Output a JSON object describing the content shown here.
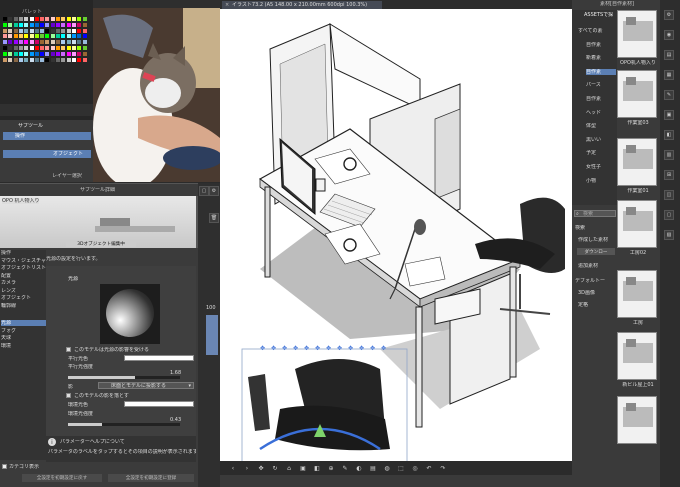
{
  "color_set_panel": {
    "title": "パレット"
  },
  "layer_panel": {
    "tools": [
      "サブツール"
    ],
    "items": [
      {
        "label": "操作"
      },
      {
        "label": "オブジェクト"
      }
    ],
    "footer": "レイヤー選択"
  },
  "subtool_detail": {
    "title": "サブツール詳細",
    "object_name": "OPO 机人物入り",
    "edit_button": "3Dオブジェクト編集中",
    "description": "光源の設定を行います。",
    "categories": [
      "操作",
      "マウス・ジェスチャー",
      "オブジェクトリスト",
      "配置",
      "カメラ",
      "レンズ",
      "オブジェクト",
      "輪郭線",
      "光源",
      "フォグ",
      "天球",
      "環境"
    ],
    "section_title": "光源",
    "receive_light": "このモデルは光源の影響を受ける",
    "parallel_color": "平行光色",
    "parallel_intensity": "平行光強度",
    "parallel_intensity_value": "1.68",
    "shadow": "影",
    "shadow_option": "床面とモデルに投影する",
    "cast_shadow": "このモデルの影を落とす",
    "ambient_color": "環境光色",
    "ambient_intensity": "環境光強度",
    "ambient_intensity_value": "0.43",
    "help_title": "パラメーターヘルプについて",
    "help_text": "パラメータのラベルをタップするとその項目の説明が表示されます。",
    "show_category": "カテゴリ表示",
    "reset_all": "全設定を初期設定に戻す",
    "register_all": "全設定を初期設定に登録"
  },
  "canvas": {
    "tab_title": "イラスト73.2 (A5 148.00 x 210.00mm 600dpi 100.3%)",
    "zoom": "100"
  },
  "material_panel": {
    "title": "素材[自作素材]",
    "root": "ASSETSで探",
    "tree": [
      "すべての素",
      "自作素",
      "新着素",
      "自作素",
      "パース",
      "自作素",
      "ヘッド",
      "体型",
      "黒いい",
      "予定",
      "女性子",
      "小物"
    ],
    "search_placeholder": "検索",
    "filter_label": "検索",
    "created_label": "作成した素材",
    "download_button": "ダウンロー",
    "added_label": "追加素材",
    "default_label": "デフォルトー",
    "three_d_label": "3D画像",
    "fixed_label": "定格",
    "thumbs": [
      "OPO机人物入り",
      "作業室03",
      "作業室01",
      "工房02",
      "工房",
      "新ビル屋上01"
    ]
  },
  "colors": {
    "accent": "#5b7fb4",
    "canvas_bg": "#ffffff",
    "panel": "#3a3a3a"
  }
}
